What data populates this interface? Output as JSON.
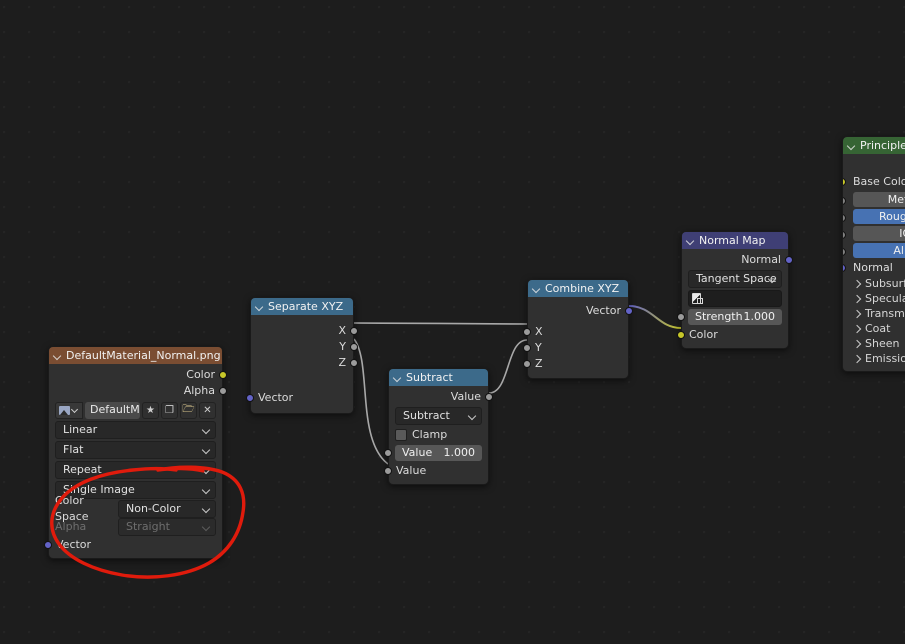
{
  "app": {
    "name": "Blender Shader Editor",
    "background_color": "#1d1d1d"
  },
  "colors": {
    "header_texture": "#7a4d32",
    "header_converter": "#3c6a8a",
    "header_vector": "#3f3f75",
    "header_shader": "#366434",
    "socket_color": "#c7c729",
    "socket_vector": "#6363c7",
    "socket_value": "#9b9b9b",
    "annotation": "#e01b0c",
    "accent_slider": "#4772b3"
  },
  "nodes": {
    "image_texture": {
      "title": "DefaultMaterial_Normal.png",
      "outputs": [
        {
          "label": "Color",
          "socket": "color-socket"
        },
        {
          "label": "Alpha",
          "socket": "value-socket"
        }
      ],
      "image_name": "DefaultMaterial...",
      "id_buttons": [
        "fake-user-icon",
        "duplicate-icon",
        "open-folder-icon",
        "unlink-x-icon"
      ],
      "interpolation": "Linear",
      "projection": "Flat",
      "extension": "Repeat",
      "source": "Single Image",
      "color_space_label": "Color Space",
      "color_space_value": "Non-Color",
      "alpha_label": "Alpha",
      "alpha_value": "Straight",
      "alpha_disabled": true,
      "inputs": [
        {
          "label": "Vector",
          "socket": "vector-socket"
        }
      ]
    },
    "separate_xyz": {
      "title": "Separate XYZ",
      "outputs": [
        {
          "label": "X",
          "socket": "value-socket"
        },
        {
          "label": "Y",
          "socket": "value-socket"
        },
        {
          "label": "Z",
          "socket": "value-socket"
        }
      ],
      "inputs": [
        {
          "label": "Vector",
          "socket": "vector-socket"
        }
      ]
    },
    "subtract": {
      "title": "Subtract",
      "outputs": [
        {
          "label": "Value",
          "socket": "value-socket"
        }
      ],
      "operation": "Subtract",
      "clamp_label": "Clamp",
      "clamp_checked": false,
      "value_slider_label": "Value",
      "value_slider_value": "1.000",
      "inputs": [
        {
          "label": "Value",
          "socket": "value-socket"
        }
      ]
    },
    "combine_xyz": {
      "title": "Combine XYZ",
      "outputs": [
        {
          "label": "Vector",
          "socket": "vector-socket"
        }
      ],
      "inputs": [
        {
          "label": "X",
          "socket": "value-socket"
        },
        {
          "label": "Y",
          "socket": "value-socket"
        },
        {
          "label": "Z",
          "socket": "value-socket"
        }
      ]
    },
    "normal_map": {
      "title": "Normal Map",
      "outputs": [
        {
          "label": "Normal",
          "socket": "vector-socket"
        }
      ],
      "space": "Tangent Space",
      "uv_map": "",
      "strength_label": "Strength",
      "strength_value": "1.000",
      "inputs": [
        {
          "label": "Color",
          "socket": "color-socket"
        }
      ]
    },
    "principled_bsdf": {
      "title": "Principled B",
      "full_title": "Principled BSDF",
      "inputs": [
        {
          "label": "Base Color",
          "socket": "color-socket",
          "style": "plain"
        },
        {
          "label": "Metallic",
          "socket": "value-socket",
          "style": "pill"
        },
        {
          "label": "Roughness",
          "socket": "value-socket",
          "style": "pill-accent"
        },
        {
          "label": "IOR",
          "socket": "value-socket",
          "style": "pill"
        },
        {
          "label": "Alpha",
          "socket": "value-socket",
          "style": "pill-accent"
        },
        {
          "label": "Normal",
          "socket": "vector-socket",
          "style": "plain"
        }
      ],
      "panels": [
        "Subsurface",
        "Specular",
        "Transmissio",
        "Coat",
        "Sheen",
        "Emission"
      ]
    }
  },
  "links": [
    {
      "from": "image_texture.Color",
      "to": "separate_xyz.Vector"
    },
    {
      "from": "separate_xyz.X",
      "to": "combine_xyz.X"
    },
    {
      "from": "separate_xyz.Y",
      "to": "subtract.Value"
    },
    {
      "from": "separate_xyz.Z",
      "to": "combine_xyz.Z"
    },
    {
      "from": "subtract.Value",
      "to": "combine_xyz.Y"
    },
    {
      "from": "combine_xyz.Vector",
      "to": "normal_map.Color"
    },
    {
      "from": "normal_map.Normal",
      "to": "principled_bsdf.Normal"
    }
  ],
  "annotation": {
    "type": "freehand-ellipse",
    "color": "#e01b0c",
    "encircles": "image-texture-lower-settings"
  }
}
